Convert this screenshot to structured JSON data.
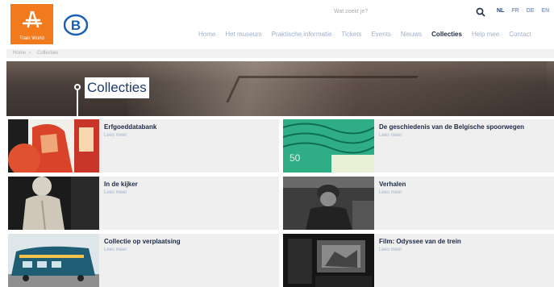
{
  "header": {
    "logo_text": "Train World",
    "search_placeholder": "Wat zoekt je?",
    "languages": [
      "NL",
      "FR",
      "DE",
      "EN"
    ],
    "active_language": "NL",
    "nav": [
      "Home",
      "Het museum",
      "Praktische informatie",
      "Tickets",
      "Events",
      "Nieuws",
      "Collecties",
      "Help mee",
      "Contact"
    ],
    "active_nav": "Collecties"
  },
  "breadcrumb": [
    "Home",
    "Collecties"
  ],
  "hero": {
    "title": "Collecties"
  },
  "cards": [
    {
      "title": "Erfgoeddatabank",
      "link": "Lees meer"
    },
    {
      "title": "De geschiedenis van de Belgische spoorwegen",
      "link": "Lees meer"
    },
    {
      "title": "In de kijker",
      "link": "Lees meer"
    },
    {
      "title": "Verhalen",
      "link": "Lees meer"
    },
    {
      "title": "Collectie op verplaatsing",
      "link": "Lees meer"
    },
    {
      "title": "Film: Odyssee van de trein",
      "link": "Lees meer"
    }
  ],
  "colors": {
    "brand_orange": "#f07a1c",
    "nav_dark": "#1e2a44",
    "link_blue": "#9fb0cc",
    "sncb_blue": "#1a5fb4"
  }
}
